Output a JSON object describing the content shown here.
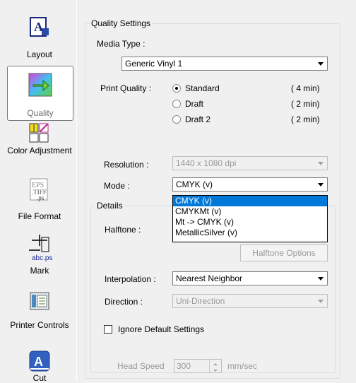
{
  "sidebar": {
    "items": [
      {
        "label": "Layout",
        "icon": "layout-icon"
      },
      {
        "label": "Quality",
        "icon": "quality-icon"
      },
      {
        "label": "Color Adjustment",
        "icon": "color-adjustment-icon"
      },
      {
        "label": "File Format",
        "icon": "file-format-icon"
      },
      {
        "label": "Mark",
        "icon": "mark-icon"
      },
      {
        "label": "Printer Controls",
        "icon": "printer-controls-icon"
      },
      {
        "label": "Cut",
        "icon": "cut-icon"
      }
    ]
  },
  "quality": {
    "group_title": "Quality Settings",
    "media_type_label": "Media Type :",
    "media_type_value": "Generic Vinyl 1",
    "print_quality_label": "Print Quality :",
    "options": [
      {
        "label": "Standard",
        "time": "( 4 min)",
        "selected": true
      },
      {
        "label": "Draft",
        "time": "( 2 min)",
        "selected": false
      },
      {
        "label": "Draft 2",
        "time": "( 2 min)",
        "selected": false
      }
    ],
    "resolution_label": "Resolution :",
    "resolution_value": "1440 x 1080 dpi",
    "mode_label": "Mode :",
    "mode_value": "CMYK (v)",
    "mode_options": [
      "CMYK (v)",
      "CMYKMt (v)",
      "Mt -> CMYK (v)",
      "MetallicSilver (v)"
    ]
  },
  "details": {
    "group_title": "Details",
    "halftone_label": "Halftone :",
    "halftone_options_button": "Halftone Options",
    "interpolation_label": "Interpolation :",
    "interpolation_value": "Nearest Neighbor",
    "direction_label": "Direction :",
    "direction_value": "Uni-Direction",
    "ignore_defaults_label": "Ignore Default Settings",
    "head_speed_label": "Head Speed",
    "head_speed_value": "300",
    "head_speed_unit": "mm/sec"
  },
  "colors": {
    "selection": "#0078d7",
    "group_border": "#d5dfe5"
  }
}
